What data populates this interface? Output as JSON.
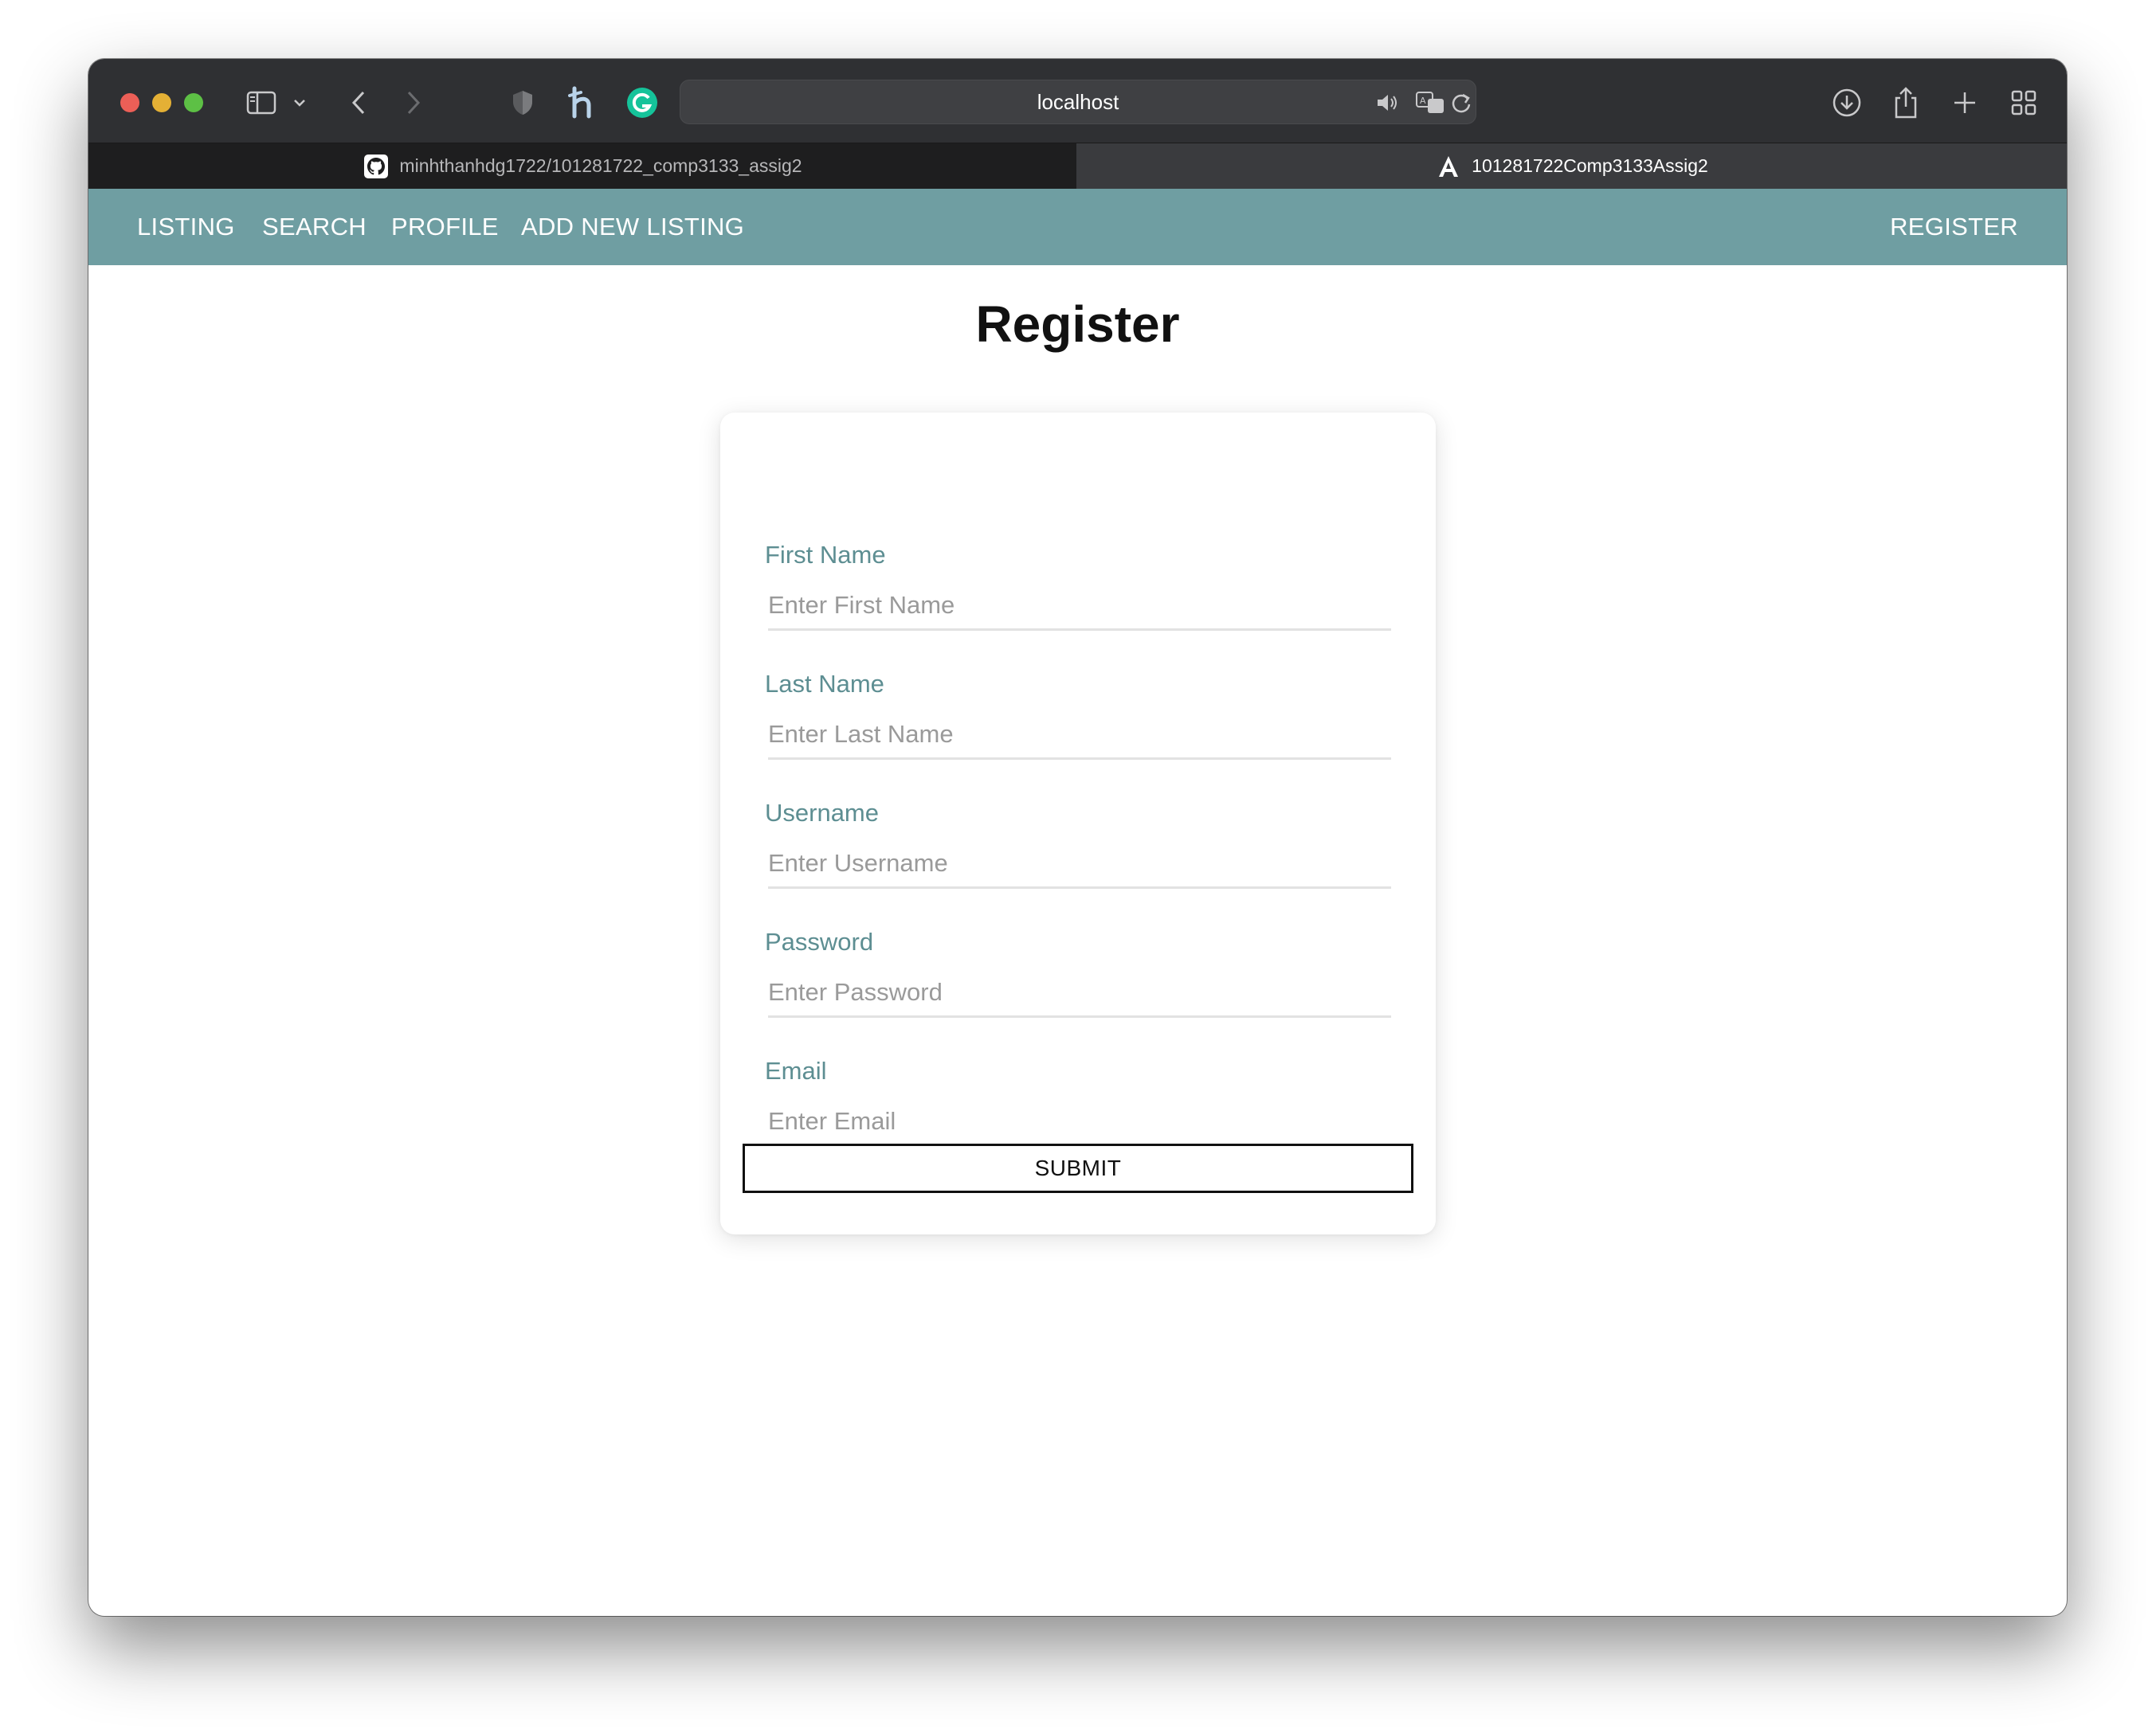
{
  "browser": {
    "url": "localhost",
    "tabs": [
      {
        "title": "minhthanhdg1722/101281722_comp3133_assig2",
        "icon": "github-icon",
        "active": false
      },
      {
        "title": "101281722Comp3133Assig2",
        "icon": "angular-icon",
        "active": true
      }
    ],
    "toolbar_icons": [
      "sidebar-icon",
      "chevron-down-icon",
      "back-icon",
      "forward-icon",
      "shield-icon",
      "honey-icon",
      "grammarly-icon",
      "speaker-icon",
      "translate-icon",
      "reload-icon",
      "download-icon",
      "share-icon",
      "new-tab-icon",
      "tab-overview-icon"
    ]
  },
  "nav": {
    "items": [
      "LISTING",
      "SEARCH",
      "PROFILE",
      "ADD NEW LISTING"
    ],
    "right_item": "REGISTER",
    "background_color": "#6f9ea2"
  },
  "page": {
    "title": "Register"
  },
  "form": {
    "fields": [
      {
        "label": "First Name",
        "placeholder": "Enter First Name",
        "value": ""
      },
      {
        "label": "Last Name",
        "placeholder": "Enter Last Name",
        "value": ""
      },
      {
        "label": "Username",
        "placeholder": "Enter Username",
        "value": ""
      },
      {
        "label": "Password",
        "placeholder": "Enter Password",
        "value": ""
      },
      {
        "label": "Email",
        "placeholder": "Enter Email",
        "value": ""
      }
    ],
    "submit_label": "SUBMIT",
    "label_color": "#5d8e92"
  }
}
